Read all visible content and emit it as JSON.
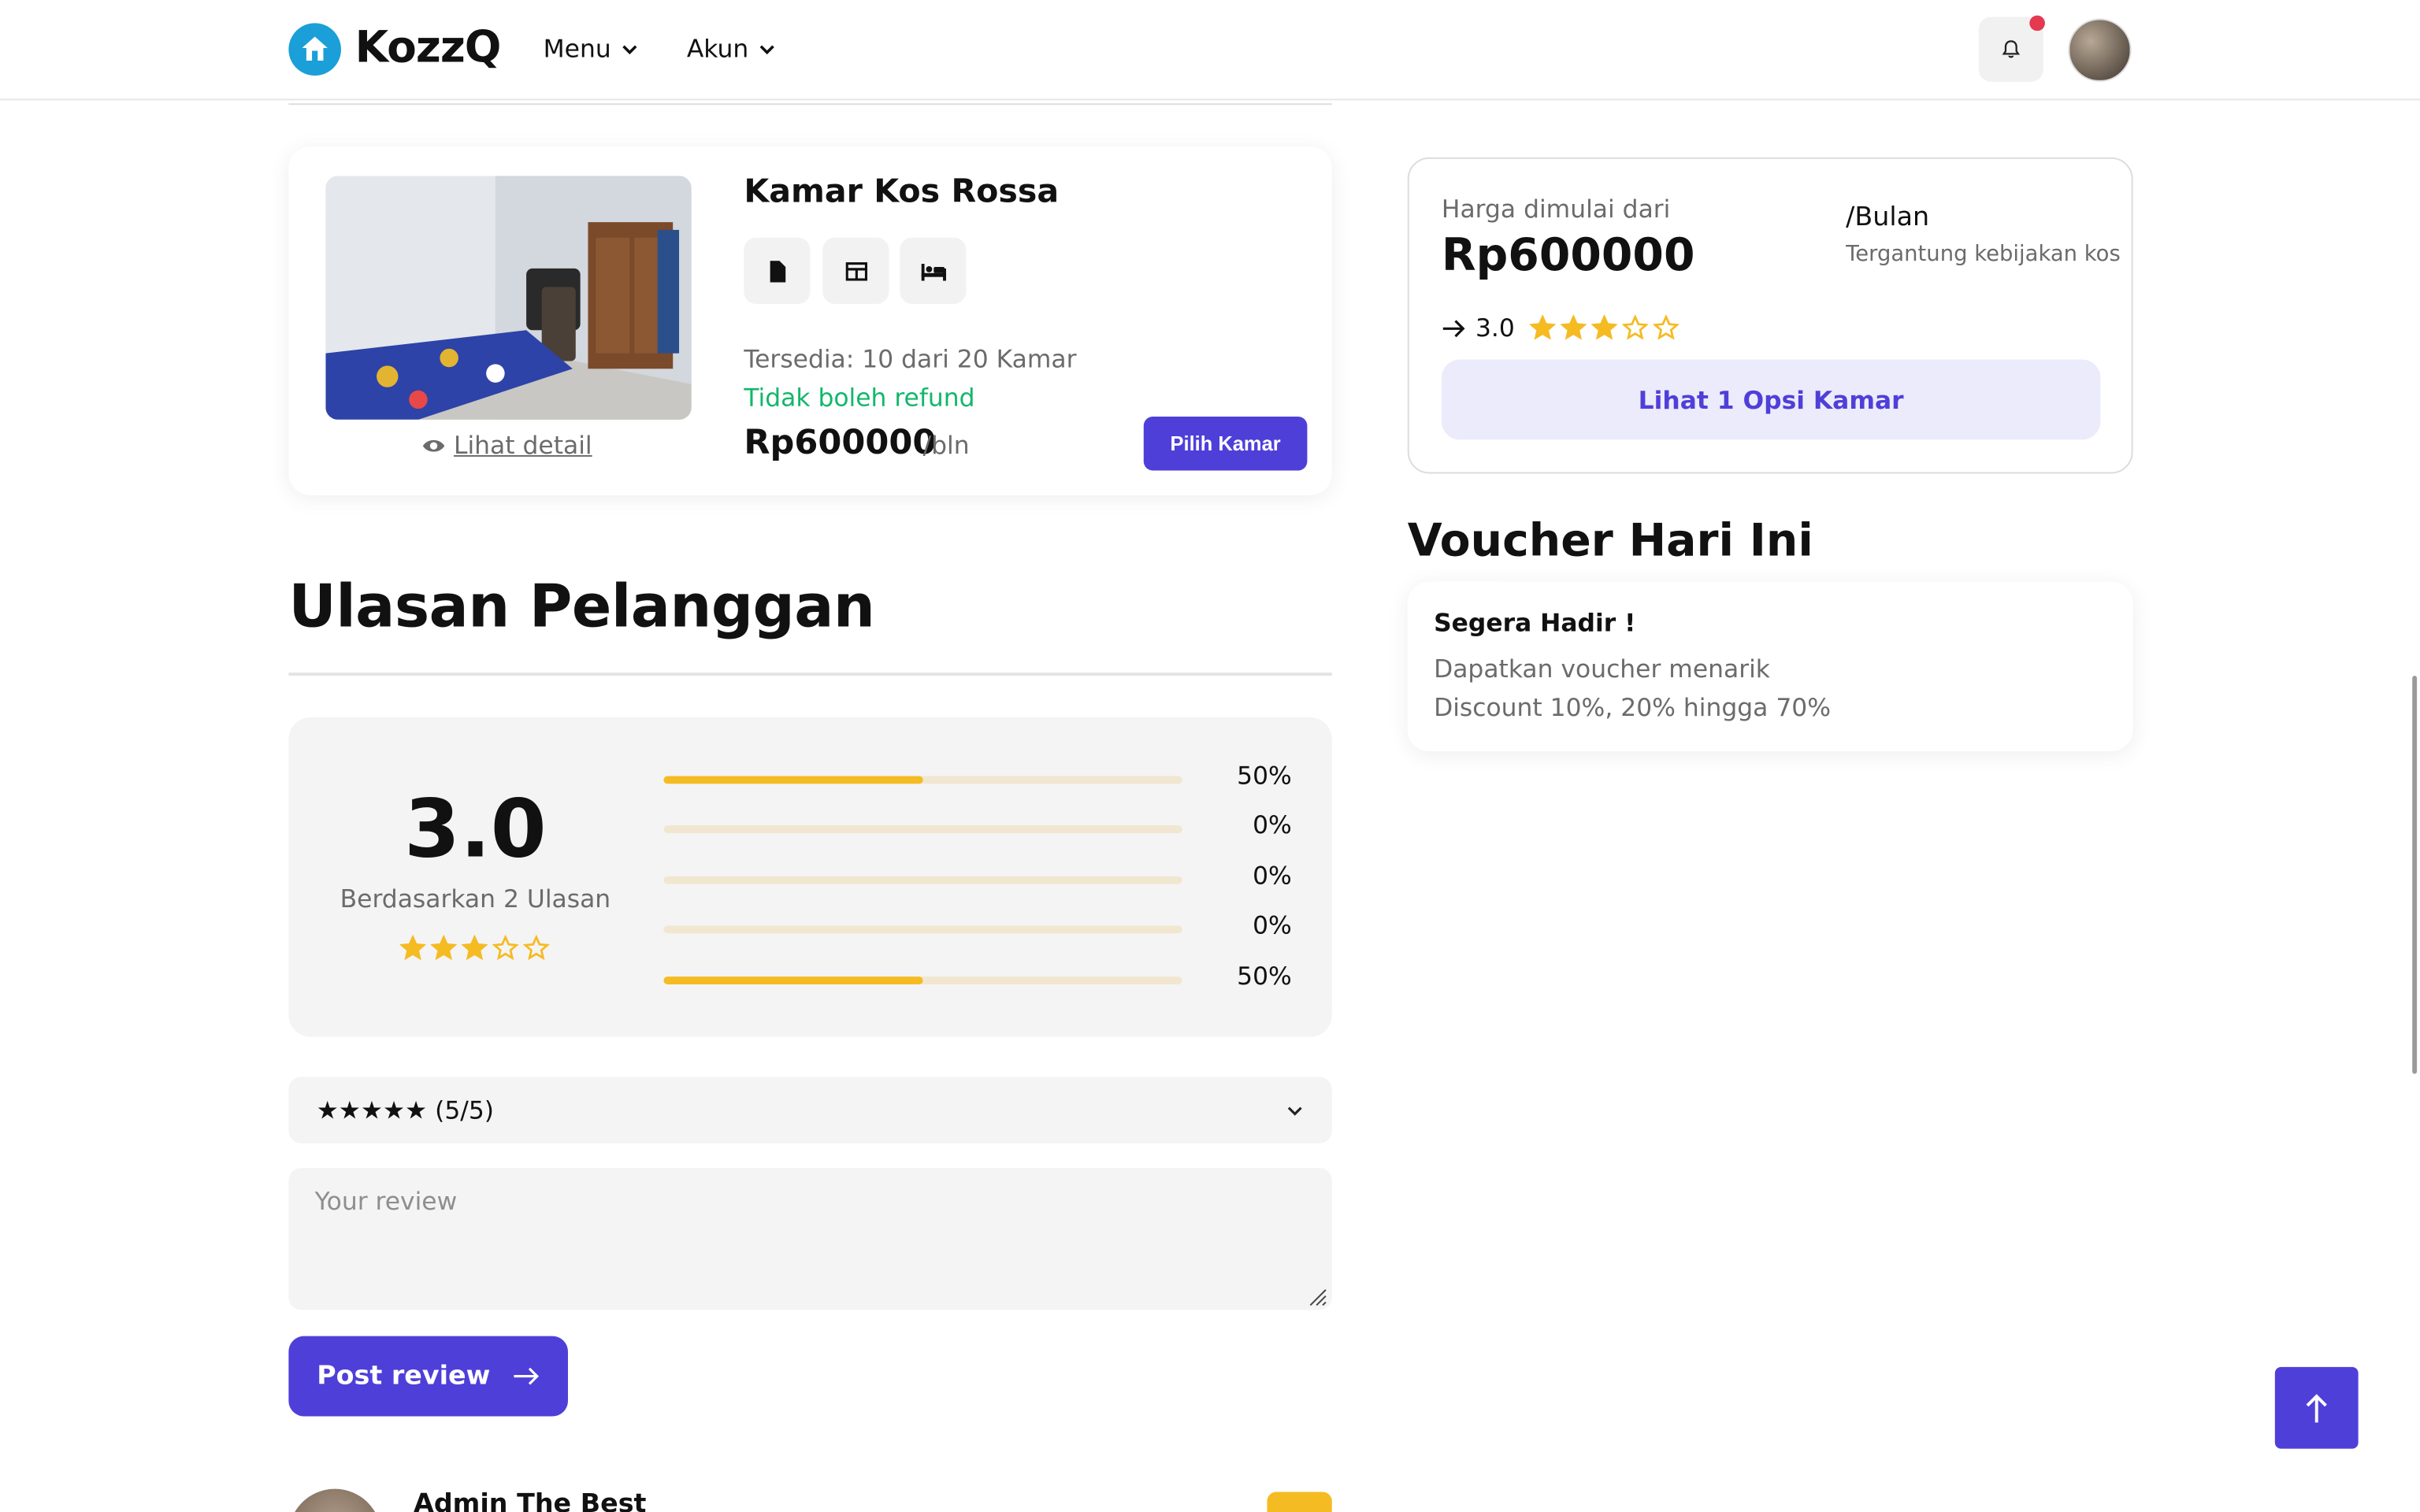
{
  "brand": {
    "name": "KozzQ",
    "color": "#1a9fd8"
  },
  "nav": {
    "menu_label": "Menu",
    "account_label": "Akun"
  },
  "header": {
    "bell_icon": "bell-icon",
    "has_notification": true
  },
  "room": {
    "title": "Kamar Kos Rossa",
    "amenity_icons": [
      "document-icon",
      "table-icon",
      "bed-icon"
    ],
    "availability": "Tersedia: 10 dari 20 Kamar",
    "refund": "Tidak boleh refund",
    "price": "Rp600000",
    "price_unit": "/bln",
    "detail_link": "Lihat detail",
    "pick_label": "Pilih Kamar"
  },
  "reviews": {
    "heading": "Ulasan Pelanggan",
    "score": "3.0",
    "based_on": "Berdasarkan 2 Ulasan",
    "star_rating": 3,
    "breakdown": [
      {
        "percent": 50,
        "label": "50%"
      },
      {
        "percent": 0,
        "label": "0%"
      },
      {
        "percent": 0,
        "label": "0%"
      },
      {
        "percent": 0,
        "label": "0%"
      },
      {
        "percent": 50,
        "label": "50%"
      }
    ],
    "select_value": "★★★★★ (5/5)",
    "review_placeholder": "Your review",
    "post_label": "Post review",
    "first_reviewer": "Admin The Best"
  },
  "pricing": {
    "label": "Harga dimulai dari",
    "price": "Rp600000",
    "per": "/Bulan",
    "note": "Tergantung kebijakan kos",
    "rating": "3.0",
    "star_rating": 3,
    "options_label": "Lihat 1 Opsi Kamar"
  },
  "voucher": {
    "heading": "Voucher Hari Ini",
    "title": "Segera Hadir !",
    "line1": "Dapatkan voucher menarik",
    "line2": "Discount 10%, 20% hingga 70%"
  },
  "colors": {
    "primary": "#4f3fd9",
    "star": "#f5bb22",
    "success": "#12b76a",
    "notification": "#e53950"
  }
}
